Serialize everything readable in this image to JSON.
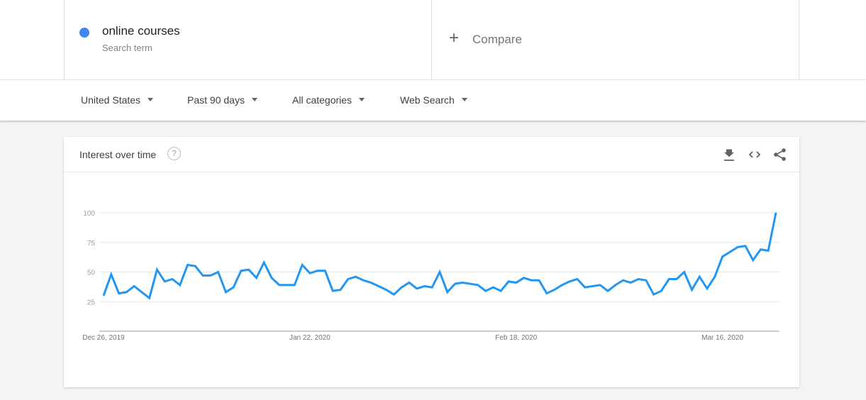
{
  "search_term": {
    "name": "online courses",
    "subtitle": "Search term",
    "color": "#4285f4"
  },
  "compare": {
    "icon": "plus-icon",
    "label": "Compare"
  },
  "filters": [
    {
      "label": "United States"
    },
    {
      "label": "Past 90 days"
    },
    {
      "label": "All categories"
    },
    {
      "label": "Web Search"
    }
  ],
  "card": {
    "title": "Interest over time",
    "help_icon": "help-icon",
    "actions": [
      "download-icon",
      "embed-code-icon",
      "share-icon"
    ]
  },
  "chart_data": {
    "type": "line",
    "title": "Interest over time",
    "xlabel": "",
    "ylabel": "",
    "ylim": [
      0,
      100
    ],
    "yticks": [
      25,
      50,
      75,
      100
    ],
    "x_tick_labels": [
      {
        "label": "Dec 26, 2019",
        "index": 0
      },
      {
        "label": "Jan 22, 2020",
        "index": 27
      },
      {
        "label": "Feb 18, 2020",
        "index": 54
      },
      {
        "label": "Mar 16, 2020",
        "index": 81
      }
    ],
    "grid": true,
    "legend": "none",
    "series": [
      {
        "name": "online courses",
        "color": "#2196f3",
        "values": [
          30,
          48,
          32,
          33,
          38,
          33,
          28,
          52,
          42,
          44,
          39,
          56,
          55,
          47,
          47,
          50,
          33,
          37,
          51,
          52,
          45,
          58,
          45,
          39,
          39,
          39,
          56,
          49,
          51,
          51,
          34,
          35,
          44,
          46,
          43,
          41,
          38,
          35,
          31,
          37,
          41,
          36,
          38,
          37,
          50,
          33,
          40,
          41,
          40,
          39,
          34,
          37,
          34,
          42,
          41,
          45,
          43,
          43,
          32,
          35,
          39,
          42,
          44,
          37,
          38,
          39,
          34,
          39,
          43,
          41,
          44,
          43,
          31,
          34,
          44,
          44,
          50,
          35,
          46,
          36,
          46,
          63,
          67,
          71,
          72,
          60,
          69,
          68,
          100
        ]
      }
    ]
  }
}
